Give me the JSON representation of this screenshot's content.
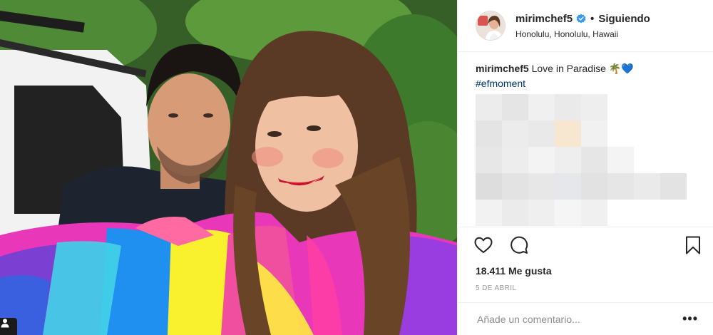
{
  "post": {
    "username": "mirimchef5",
    "follow_status": "Siguiendo",
    "location": "Honolulu, Honolulu, Hawaii",
    "caption": {
      "username": "mirimchef5",
      "text": "Love in Paradise",
      "emojis": "🌴💙",
      "hashtag": "#efmoment"
    },
    "likes": "18.411 Me gusta",
    "date": "5 DE ABRIL",
    "comment_placeholder": "Añade un comentario...",
    "more_options": "•••"
  },
  "icons": {
    "verified": "verified-badge-icon",
    "like": "heart-icon",
    "comment": "speech-bubble-icon",
    "save": "bookmark-icon",
    "user_tag": "person-icon",
    "more": "ellipsis-icon"
  },
  "colors": {
    "verified_blue": "#3897f0",
    "hashtag_blue": "#003569",
    "border": "#efefef",
    "muted_text": "#999999"
  }
}
